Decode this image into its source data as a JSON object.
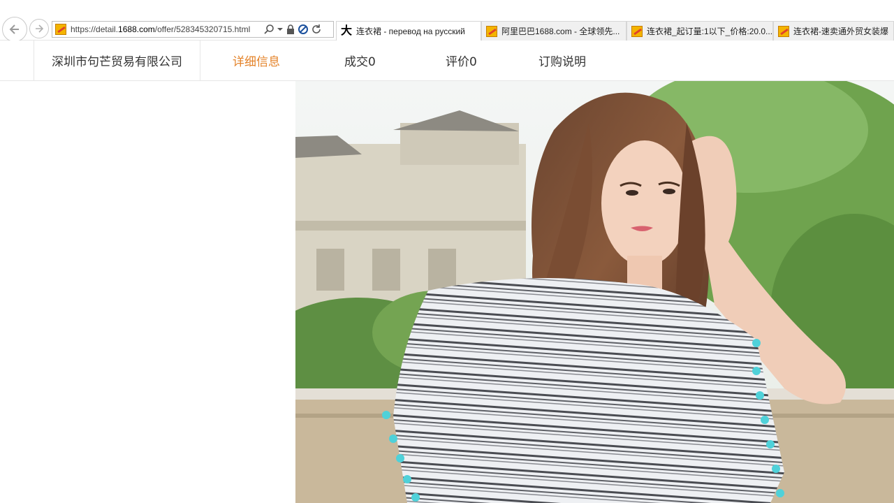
{
  "browser": {
    "url_prefix": "https://detail.",
    "url_domain": "1688.com",
    "url_path": "/offer/528345320715.html",
    "tabs": [
      {
        "label": "连衣裙 - перевод на русский",
        "icon": "translate-da-icon",
        "active": true
      },
      {
        "label": "阿里巴巴1688.com - 全球领先...",
        "icon": "alibaba-favicon",
        "active": false
      },
      {
        "label": "连衣裙_起订量:1以下_价格:20.0...",
        "icon": "alibaba-favicon",
        "active": false
      },
      {
        "label": "连衣裙-速卖通外贸女装爆",
        "icon": "alibaba-favicon",
        "active": false
      }
    ]
  },
  "page_nav": {
    "company": "深圳市句芒贸易有限公司",
    "tabs": [
      {
        "label": "详细信息",
        "active": true
      },
      {
        "label": "成交0",
        "active": false
      },
      {
        "label": "评价0",
        "active": false
      },
      {
        "label": "订购说明",
        "active": false
      }
    ]
  },
  "colors": {
    "active_tab": "#e4832a",
    "border": "#e6e6e6",
    "tassel": "#4fd1d9"
  }
}
